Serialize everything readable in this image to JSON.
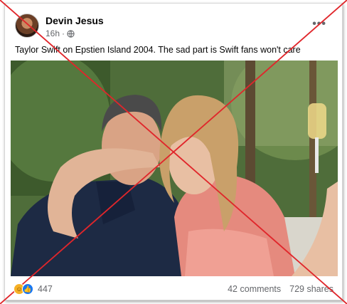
{
  "post": {
    "author": "Devin Jesus",
    "time": "16h",
    "more": "•••",
    "caption": "Taylor Swift on Epstien Island 2004. The sad part is Swift fans won't care"
  },
  "footer": {
    "reaction_count": "447",
    "comments": "42 comments",
    "shares": "729 shares"
  },
  "icons": {
    "audience": "globe-icon",
    "reactions": [
      "haha-reaction-icon",
      "like-reaction-icon"
    ]
  },
  "colors": {
    "cross_mark": "#e0262b",
    "like_blue": "#1877f2",
    "haha_yellow": "#f7b125",
    "meta_gray": "#65676b"
  }
}
